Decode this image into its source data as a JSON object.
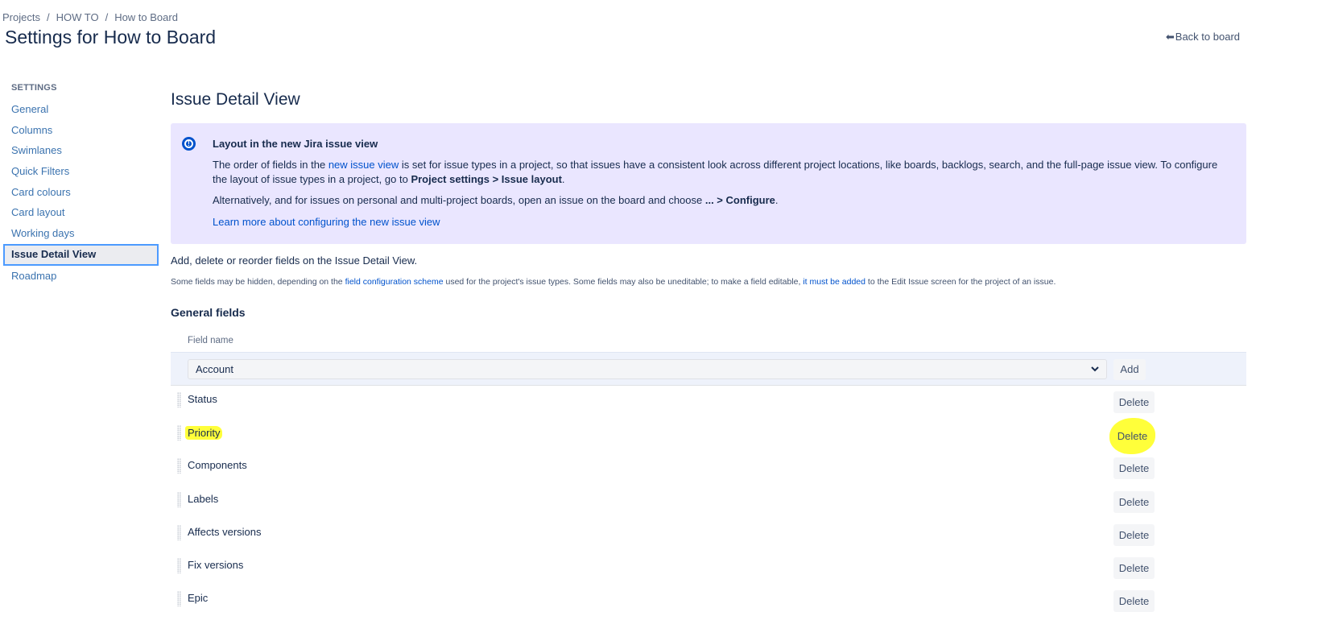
{
  "breadcrumb": [
    {
      "label": "Projects"
    },
    {
      "label": "HOW TO"
    },
    {
      "label": "How to Board"
    }
  ],
  "breadcrumb_separator": "/",
  "page_title": "Settings for How to Board",
  "back_link": {
    "icon": "back-arrow-icon",
    "glyph": "⬅",
    "label": "Back to board"
  },
  "sidebar": {
    "heading": "SETTINGS",
    "items": [
      {
        "label": "General",
        "active": false
      },
      {
        "label": "Columns",
        "active": false
      },
      {
        "label": "Swimlanes",
        "active": false
      },
      {
        "label": "Quick Filters",
        "active": false
      },
      {
        "label": "Card colours",
        "active": false
      },
      {
        "label": "Card layout",
        "active": false
      },
      {
        "label": "Working days",
        "active": false
      },
      {
        "label": "Issue Detail View",
        "active": true
      },
      {
        "label": "Roadmap",
        "active": false
      }
    ]
  },
  "main": {
    "title": "Issue Detail View",
    "info_panel": {
      "icon": "info-icon",
      "title": "Layout in the new Jira issue view",
      "p1_before": "The order of fields in the ",
      "p1_link": "new issue view",
      "p1_middle": " is set for issue types in a project, so that issues have a consistent look across different project locations, like boards, backlogs, search, and the full-page issue view. To configure the layout of issue types in a project, go to ",
      "p1_bold": "Project settings > Issue layout",
      "p1_end": ".",
      "p2_before": "Alternatively, and for issues on personal and multi-project boards, open an issue on the board and choose ",
      "p2_bold": "... > Configure",
      "p2_end": ".",
      "link": "Learn more about configuring the new issue view"
    },
    "intro": "Add, delete or reorder fields on the Issue Detail View.",
    "note": {
      "part1": "Some fields may be hidden, depending on the ",
      "link1": "field configuration scheme",
      "part2": " used for the project's issue types. Some fields may also be uneditable; to make a field editable, ",
      "link2": "it must be added",
      "part3": " to the Edit Issue screen for the project of an issue."
    },
    "group_title": "General fields",
    "table": {
      "column_header": "Field name",
      "select_value": "Account",
      "select_chevron": "⌄",
      "add_label": "Add",
      "delete_label": "Delete",
      "rows": [
        {
          "name": "Status",
          "highlighted": false
        },
        {
          "name": "Priority",
          "highlighted": true
        },
        {
          "name": "Components",
          "highlighted": false
        },
        {
          "name": "Labels",
          "highlighted": false
        },
        {
          "name": "Affects versions",
          "highlighted": false
        },
        {
          "name": "Fix versions",
          "highlighted": false
        },
        {
          "name": "Epic",
          "highlighted": false
        }
      ]
    }
  },
  "colors": {
    "info_panel_bg": "#eae6ff",
    "link": "#0052cc",
    "sidebar_link": "#3b73af",
    "highlight": "#ffff3a",
    "active_border": "#4c9aff"
  }
}
